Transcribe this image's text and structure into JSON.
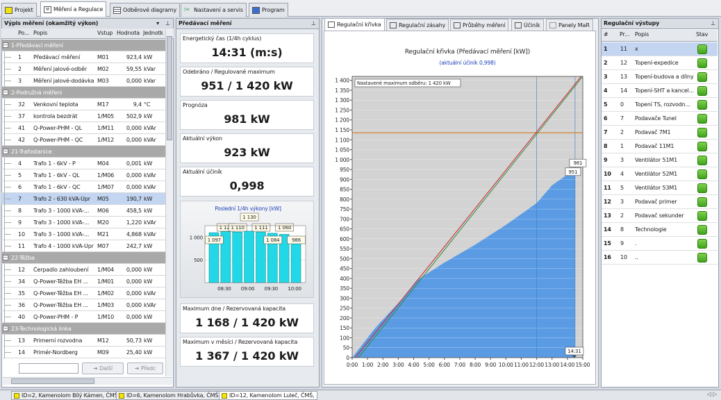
{
  "tabs": [
    {
      "label": "Projekt",
      "icon": "folder-icon"
    },
    {
      "label": "Měření a Regulace",
      "icon": "mar-icon"
    },
    {
      "label": "Odběrové diagramy",
      "icon": "grid-icon"
    },
    {
      "label": "Nastavení a servis",
      "icon": "tools-icon"
    },
    {
      "label": "Program",
      "icon": "program-icon"
    }
  ],
  "left": {
    "title": "Výpis měření (okamžitý výkon)",
    "cols": [
      "Po...",
      "Popis",
      "Vstup",
      "Hodnota",
      "Jednotk"
    ],
    "rows": [
      {
        "g": "1-Předávací měření"
      },
      {
        "n": "1",
        "d": "Předávací měření",
        "v": "M01",
        "h": "923,4",
        "u": "kW"
      },
      {
        "n": "2",
        "d": "Měření jalové-odběr",
        "v": "M02",
        "h": "59,55",
        "u": "kVar"
      },
      {
        "n": "3",
        "d": "Měření jalové-dodávka",
        "v": "M03",
        "h": "0,000",
        "u": "kVar"
      },
      {
        "g": "2-Podružná měření"
      },
      {
        "n": "32",
        "d": "Venkovní teplota",
        "v": "M17",
        "h": "9,4",
        "u": "°C"
      },
      {
        "n": "37",
        "d": "kontrola bezdrát",
        "v": "1/M05",
        "h": "502,9",
        "u": "kW"
      },
      {
        "n": "41",
        "d": "Q-Power-PHM - QL",
        "v": "1/M11",
        "h": "0,000",
        "u": "kVAr"
      },
      {
        "n": "42",
        "d": "Q-Power-PHM - QC",
        "v": "1/M12",
        "h": "0,000",
        "u": "kVAr"
      },
      {
        "g": "21-Trafostanice"
      },
      {
        "n": "4",
        "d": "Trafo 1 - 6kV - P",
        "v": "M04",
        "h": "0,001",
        "u": "kW"
      },
      {
        "n": "5",
        "d": "Trafo 1 - 6kV - QL",
        "v": "1/M06",
        "h": "0,000",
        "u": "kVAr"
      },
      {
        "n": "6",
        "d": "Trafo 1 - 6kV - QC",
        "v": "1/M07",
        "h": "0,000",
        "u": "kVAr"
      },
      {
        "n": "7",
        "d": "Trafo 2 - 630 kVA-Úpr",
        "v": "M05",
        "h": "190,7",
        "u": "kW",
        "sel": true
      },
      {
        "n": "8",
        "d": "Trafo 3 - 1000 kVA-...",
        "v": "M06",
        "h": "458,5",
        "u": "kW"
      },
      {
        "n": "9",
        "d": "Trafo 3 - 1000 kVA-...",
        "v": "M20",
        "h": "1,220",
        "u": "kVAr"
      },
      {
        "n": "10",
        "d": "Trafo 3 - 1000 kVA-...",
        "v": "M21",
        "h": "4,868",
        "u": "kVAr"
      },
      {
        "n": "11",
        "d": "Trafo 4 - 1000 kVA-Úpr",
        "v": "M07",
        "h": "242,7",
        "u": "kW"
      },
      {
        "g": "22-Těžba"
      },
      {
        "n": "12",
        "d": "Čerpadlo zahloubení",
        "v": "1/M04",
        "h": "0,000",
        "u": "kW"
      },
      {
        "n": "34",
        "d": "Q-Power-Těžba EH ...",
        "v": "1/M01",
        "h": "0,000",
        "u": "kW"
      },
      {
        "n": "35",
        "d": "Q-Power-Těžba EH ...",
        "v": "1/M02",
        "h": "0,000",
        "u": "kVAr"
      },
      {
        "n": "36",
        "d": "Q-Power-Těžba EH ...",
        "v": "1/M03",
        "h": "0,000",
        "u": "kVAr"
      },
      {
        "n": "40",
        "d": "Q-Power-PHM - P",
        "v": "1/M10",
        "h": "0,000",
        "u": "kW"
      },
      {
        "g": "23-Technologická linka"
      },
      {
        "n": "13",
        "d": "Primerní rozvodna",
        "v": "M12",
        "h": "50,73",
        "u": "kW"
      },
      {
        "n": "14",
        "d": "Primér-Nordberg",
        "v": "M09",
        "h": "25,40",
        "u": "kW"
      }
    ],
    "btn_next": "Další",
    "btn_prev": "Předc"
  },
  "mid": {
    "title": "Předávací měření",
    "boxes": [
      {
        "label": "Energetický čas (1/4h cyklus)",
        "value": "14:31 (m:s)"
      },
      {
        "label": "Odebráno / Regulované maximum",
        "value": "951 / 1 420 kW"
      },
      {
        "label": "Prognóza",
        "value": "981 kW"
      },
      {
        "label": "Aktuální výkon",
        "value": "923 kW"
      },
      {
        "label": "Aktuální účiník",
        "value": "0,998"
      },
      {
        "label": "Maximum dne / Rezervovaná kapacita",
        "value": "1 168 / 1 420 kW"
      },
      {
        "label": "Maximum v měsíci / Rezervovaná kapacita",
        "value": "1 367 / 1 420 kW"
      }
    ]
  },
  "chart_tabs": [
    "Regulační křivka",
    "Regulační zásahy",
    "Průběhy měření",
    "Účiník",
    "Panely MaR"
  ],
  "right": {
    "title": "Regulační výstupy",
    "cols": [
      "#",
      "Pr...",
      "Popis",
      "Stav"
    ],
    "rows": [
      {
        "n": "1",
        "p": "11",
        "d": "x",
        "sel": true
      },
      {
        "n": "2",
        "p": "12",
        "d": "Topení-expedice"
      },
      {
        "n": "3",
        "p": "13",
        "d": "Topení-budova a dílny"
      },
      {
        "n": "4",
        "p": "14",
        "d": "Topení-SHT a kancel..."
      },
      {
        "n": "5",
        "p": "0",
        "d": "Topení TS, rozvodn..."
      },
      {
        "n": "6",
        "p": "7",
        "d": "Podavače Tunel"
      },
      {
        "n": "7",
        "p": "2",
        "d": "Podavač 7M1"
      },
      {
        "n": "8",
        "p": "1",
        "d": "Podavač 11M1"
      },
      {
        "n": "9",
        "p": "3",
        "d": "Ventilátor 51M1"
      },
      {
        "n": "10",
        "p": "4",
        "d": "Ventilátor 52M1"
      },
      {
        "n": "11",
        "p": "5",
        "d": "Ventilátor 53M1"
      },
      {
        "n": "12",
        "p": "3",
        "d": "Podavač primer"
      },
      {
        "n": "13",
        "p": "2",
        "d": "Podavač sekunder"
      },
      {
        "n": "14",
        "p": "8",
        "d": "Technologie"
      },
      {
        "n": "15",
        "p": "9",
        "d": "."
      },
      {
        "n": "16",
        "p": "10",
        "d": ".."
      }
    ]
  },
  "status_tabs": [
    "ID=2, Kamenolom Bílý Kámen, ČMŠ,",
    "ID=6, Kamenolom Hrabůvka, ČMŠ,",
    "ID=12, Kamenolom Luleč, ČMŠ,"
  ],
  "colors": {
    "area": "#5a9be4",
    "limit": "#d1842f",
    "line1": "#c8202a",
    "line2": "#2e8b3a",
    "bar": "#23d8e6"
  },
  "chart_data": [
    {
      "type": "area",
      "title": "Regulační křivka (Předávací měření [kW])",
      "subtitle": "(aktuální účiník 0,998)",
      "x_ticks": [
        "0:00",
        "1:00",
        "2:00",
        "3:00",
        "4:00",
        "5:00",
        "6:00",
        "7:00",
        "8:00",
        "9:00",
        "10:00",
        "11:00",
        "12:00",
        "13:00",
        "14:00",
        "15:00"
      ],
      "y_ticks": [
        "0",
        "50",
        "100",
        "150",
        "200",
        "250",
        "300",
        "350",
        "400",
        "450",
        "500",
        "550",
        "600",
        "650",
        "700",
        "750",
        "800",
        "850",
        "900",
        "950",
        "1 000",
        "1 050",
        "1 100",
        "1 150",
        "1 200",
        "1 250",
        "1 300",
        "1 350",
        "1 400"
      ],
      "xlim": [
        0,
        15
      ],
      "ylim": [
        0,
        1420
      ],
      "limit_label": "Nastavené maximum odběru: 1 420 kW",
      "limit_value": 1420,
      "line_value": 1135,
      "series": [
        {
          "x": [
            0,
            0.3,
            1.5,
            3.3,
            4.2,
            6,
            8,
            10,
            12,
            13,
            14.1,
            14.5
          ],
          "y": [
            0,
            30,
            150,
            300,
            390,
            480,
            570,
            670,
            780,
            870,
            930,
            951
          ]
        }
      ],
      "diag_lines": [
        {
          "x": [
            0.2,
            14.9
          ],
          "y": [
            0,
            1420
          ]
        },
        {
          "x": [
            0.4,
            15
          ],
          "y": [
            0,
            1420
          ]
        }
      ],
      "end_labels": [
        "981",
        "951"
      ],
      "time_marker": "14:31"
    },
    {
      "type": "bar",
      "title": "Poslední 1/4h výkony [kW]",
      "x_ticks": [
        "08:30",
        "09:00",
        "09:30",
        "10:00"
      ],
      "y_ticks": [
        "500",
        "1 000"
      ],
      "ylim": [
        0,
        1250
      ],
      "values": [
        1097,
        1122,
        1110,
        1130,
        1111,
        1084,
        1060,
        986
      ],
      "value_labels": [
        "1 097",
        "1 122",
        "1 110",
        "1 130",
        "1 111",
        "1 084",
        "1 060",
        "986"
      ]
    }
  ]
}
